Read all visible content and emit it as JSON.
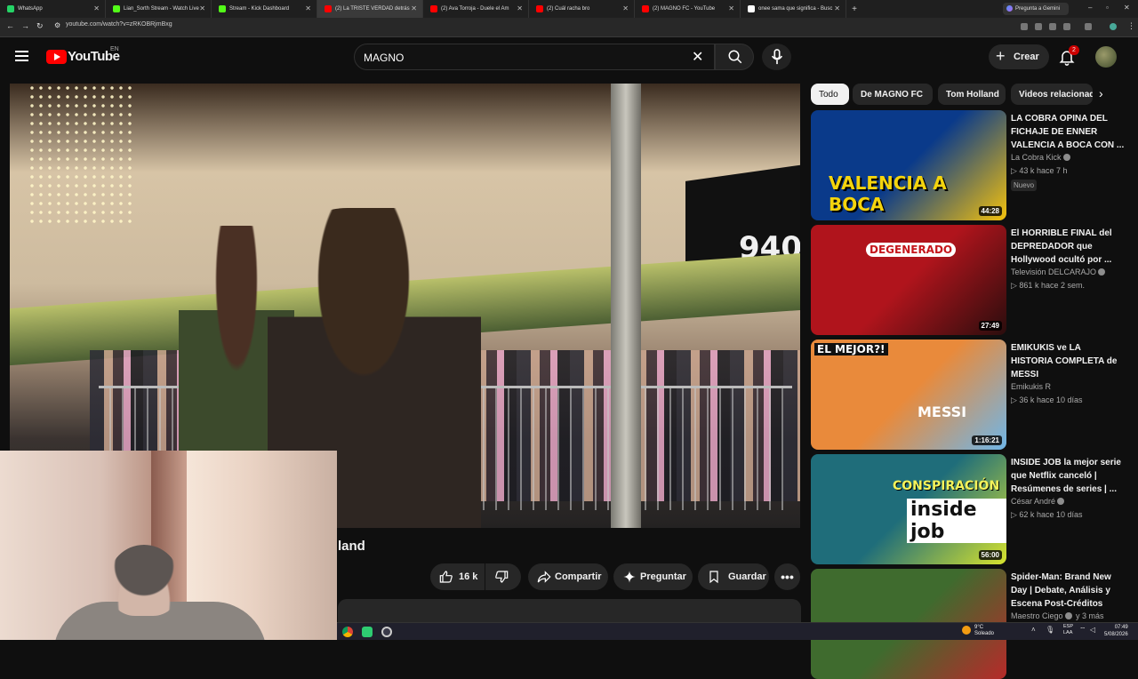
{
  "browser": {
    "tabs": [
      {
        "title": "WhatsApp",
        "color": "#25d366"
      },
      {
        "title": "Lian_Sorth Stream - Watch Live",
        "color": "#53fc18"
      },
      {
        "title": "Stream - Kick Dashboard",
        "color": "#53fc18"
      },
      {
        "title": "(2) La TRISTE VERDAD detrás",
        "color": "#ff0000"
      },
      {
        "title": "(2) Ava Torroja - Duele el Am",
        "color": "#ff0000"
      },
      {
        "title": "(2) Cuál racha bro",
        "color": "#ff0000"
      },
      {
        "title": "(2) MAGNO FC - YouTube",
        "color": "#ff0000"
      },
      {
        "title": "onee sama que significa - Busc",
        "color": "#ffffff"
      }
    ],
    "active_tab_index": 3,
    "gemini_label": "Pregunta a Gemini",
    "url": "youtube.com/watch?v=zRKOBRjmBxg"
  },
  "header": {
    "logo_text": "YouTube",
    "region": "EN",
    "search_value": "MAGNO",
    "create_label": "Crear",
    "notif_count": "2"
  },
  "video": {
    "title_visible": "land",
    "overlay_text": "940",
    "actions": {
      "likes": "16 k",
      "share": "Compartir",
      "ask": "Preguntar",
      "save": "Guardar"
    }
  },
  "chips": [
    "Todo",
    "De MAGNO FC",
    "Tom Holland",
    "Videos relacionados"
  ],
  "recommendations": [
    {
      "title": "LA COBRA OPINA DEL FICHAJE DE ENNER VALENCIA A BOCA CON ...",
      "channel": "La Cobra Kick",
      "verified": true,
      "views": "43 k",
      "age": "hace 7 h",
      "badge": "Nuevo",
      "duration": "44:28",
      "thumb_text": "VALENCIA A BOCA",
      "colors": [
        "#0a3a8a",
        "#f4c20d"
      ]
    },
    {
      "title": "El HORRIBLE FINAL del DEPREDADOR que Hollywood ocultó por ...",
      "channel": "Televisión DELCARAJO",
      "verified": true,
      "views": "861 k",
      "age": "hace 2 sem.",
      "duration": "27:49",
      "thumb_text": "DEGENERADO",
      "colors": [
        "#b0141c",
        "#2a0d0d"
      ]
    },
    {
      "title": "EMIKUKIS ve LA HISTORIA COMPLETA de MESSI",
      "channel": "Emikukis R",
      "verified": false,
      "views": "36 k",
      "age": "hace 10 días",
      "duration": "1:16:21",
      "thumb_text": "EL MEJOR?!",
      "thumb_text_2": "MESSI",
      "colors": [
        "#e98a3b",
        "#6fb6e8"
      ]
    },
    {
      "title": "INSIDE JOB la mejor serie que Netflix canceló | Resúmenes de series | ...",
      "channel": "César André",
      "verified": true,
      "views": "62 k",
      "age": "hace 10 días",
      "duration": "56:00",
      "thumb_text": "CONSPIRACIÓN",
      "thumb_text_2": "inside job",
      "colors": [
        "#1f6d7a",
        "#d7e32e"
      ]
    },
    {
      "title": "Spider-Man: Brand New Day | Debate, Análisis y Escena Post-Créditos",
      "channel": "Maestro Ciego",
      "verified": true,
      "views": "",
      "age": "y 3 más",
      "duration": "",
      "colors": [
        "#3f6b2e",
        "#b72a2a"
      ]
    }
  ],
  "taskbar": {
    "weather_temp": "9°C",
    "weather_desc": "Soleado",
    "lang_1": "ESP",
    "lang_2": "LAA",
    "time": "07:49",
    "date": "5/08/2026"
  }
}
